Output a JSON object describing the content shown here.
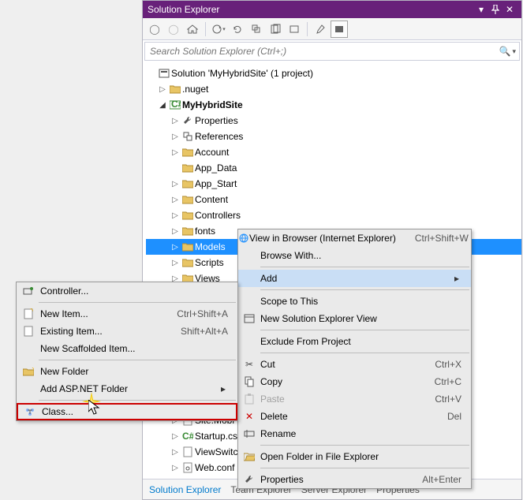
{
  "panel": {
    "title": "Solution Explorer",
    "search_placeholder": "Search Solution Explorer (Ctrl+;)"
  },
  "tree": {
    "solution": "Solution 'MyHybridSite' (1 project)",
    "nuget": ".nuget",
    "project": "MyHybridSite",
    "properties": "Properties",
    "references": "References",
    "account": "Account",
    "app_data": "App_Data",
    "app_start": "App_Start",
    "content": "Content",
    "controllers": "Controllers",
    "fonts": "fonts",
    "models": "Models",
    "scripts": "Scripts",
    "views": "Views",
    "site_mobile": "Site.Mobi",
    "startup_cs": "Startup.cs",
    "viewswitch": "ViewSwitc",
    "webconfig": "Web.conf"
  },
  "tabs": {
    "solution": "Solution Explorer",
    "team": "Team Explorer",
    "server": "Server Explorer",
    "props": "Properties"
  },
  "ctx_main": {
    "view_browser": "View in Browser (Internet Explorer)",
    "view_browser_sc": "Ctrl+Shift+W",
    "browse_with": "Browse With...",
    "add": "Add",
    "scope": "Scope to This",
    "new_sol_view": "New Solution Explorer View",
    "exclude": "Exclude From Project",
    "cut": "Cut",
    "cut_sc": "Ctrl+X",
    "copy": "Copy",
    "copy_sc": "Ctrl+C",
    "paste": "Paste",
    "paste_sc": "Ctrl+V",
    "delete": "Delete",
    "delete_sc": "Del",
    "rename": "Rename",
    "open_folder": "Open Folder in File Explorer",
    "properties": "Properties",
    "properties_sc": "Alt+Enter"
  },
  "ctx_sub": {
    "controller": "Controller...",
    "new_item": "New Item...",
    "new_item_sc": "Ctrl+Shift+A",
    "existing_item": "Existing Item...",
    "existing_item_sc": "Shift+Alt+A",
    "scaffolded": "New Scaffolded Item...",
    "new_folder": "New Folder",
    "asp_folder": "Add ASP.NET Folder",
    "class": "Class..."
  }
}
